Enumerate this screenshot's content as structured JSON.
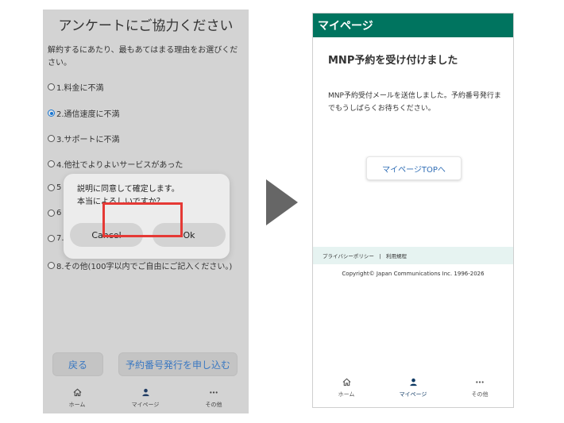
{
  "left_phone": {
    "survey_title": "アンケートにご協力ください",
    "survey_desc": "解約するにあたり、最もあてはまる理由をお選びください。",
    "options": [
      {
        "label": "1.料金に不満",
        "selected": false
      },
      {
        "label": "2.通信速度に不満",
        "selected": true
      },
      {
        "label": "3.サポートに不満",
        "selected": false
      },
      {
        "label": "4.他社でよりよいサービスがあった",
        "selected": false
      },
      {
        "label": "5",
        "selected": false
      },
      {
        "label": "6",
        "selected": false
      },
      {
        "label": "7.",
        "selected": false
      },
      {
        "label": "8.その他(100字以内でご自由にご記入ください。)",
        "selected": false
      }
    ],
    "dialog": {
      "line1": "説明に同意して確定します。",
      "line2": "本当によろしいですか？",
      "cancel": "Cancel",
      "ok": "Ok"
    },
    "back_button": "戻る",
    "apply_button": "予約番号発行を申し込む",
    "nav": [
      {
        "icon": "home-icon",
        "label": "ホーム"
      },
      {
        "icon": "person-icon",
        "label": "マイページ"
      },
      {
        "icon": "more-icon",
        "label": "その他"
      }
    ]
  },
  "right_phone": {
    "header": "マイページ",
    "title": "MNP予約を受け付けました",
    "message": "MNP予約受付メールを送信しました。予約番号発行までもうしばらくお待ちください。",
    "top_button": "マイページTOPへ",
    "footer_links": "プライバシーポリシー　|　利用規程",
    "copyright": "Copyright© Japan Communications Inc. 1996-2026",
    "nav": [
      {
        "icon": "home-icon",
        "label": "ホーム"
      },
      {
        "icon": "person-icon",
        "label": "マイページ"
      },
      {
        "icon": "more-icon",
        "label": "その他"
      }
    ]
  },
  "colors": {
    "header_green": "#00745f",
    "highlight_red": "#e53935",
    "link_blue": "#2f6db5",
    "radio_blue": "#1976d2"
  }
}
